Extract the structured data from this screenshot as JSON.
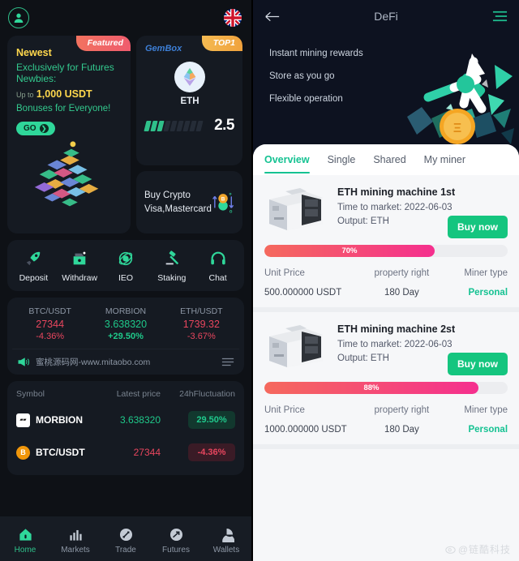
{
  "home": {
    "header": {
      "avatar_name": "user-avatar",
      "language_flag": "uk-flag"
    },
    "promo": {
      "badge": "Featured",
      "title": "Newest",
      "line2": "Exclusively for Futures Newbies:",
      "up_to": "Up to",
      "amount": "1,000 USDT",
      "line4": "Bonuses for Everyone!",
      "cta": "GO"
    },
    "gembox": {
      "label": "GemBox",
      "badge": "TOP1",
      "coin": "ETH",
      "value": "2.5",
      "bars_total": 9,
      "bars_filled": 3
    },
    "buy_crypto": {
      "line1": "Buy Crypto",
      "line2": "Visa,Mastercard"
    },
    "quick_nav": [
      {
        "label": "Deposit",
        "icon": "rocket-icon"
      },
      {
        "label": "Withdraw",
        "icon": "wallet-icon"
      },
      {
        "label": "IEO",
        "icon": "atom-icon"
      },
      {
        "label": "Staking",
        "icon": "gavel-icon"
      },
      {
        "label": "Chat",
        "icon": "headset-icon"
      }
    ],
    "tickers": [
      {
        "symbol": "BTC/USDT",
        "price": "27344",
        "change": "-4.36%",
        "dir": "down"
      },
      {
        "symbol": "MORBION",
        "price": "3.638320",
        "change": "+29.50%",
        "dir": "up"
      },
      {
        "symbol": "ETH/USDT",
        "price": "1739.32",
        "change": "-3.67%",
        "dir": "down"
      }
    ],
    "notice": {
      "text": "蜜桃源码网-www.mitaobo.com"
    },
    "market": {
      "columns": [
        "Symbol",
        "Latest price",
        "24hFluctuation"
      ],
      "rows": [
        {
          "symbol": "MORBION",
          "price": "3.638320",
          "change": "29.50%",
          "dir": "up",
          "icon": "morbion-icon"
        },
        {
          "symbol": "BTC/USDT",
          "price": "27344",
          "change": "-4.36%",
          "dir": "down",
          "icon": "btc-icon"
        }
      ]
    },
    "tabbar": [
      {
        "label": "Home",
        "icon": "home-icon",
        "active": true
      },
      {
        "label": "Markets",
        "icon": "bars-icon",
        "active": false
      },
      {
        "label": "Trade",
        "icon": "trade-icon",
        "active": false
      },
      {
        "label": "Futures",
        "icon": "futures-icon",
        "active": false
      },
      {
        "label": "Wallets",
        "icon": "pie-icon",
        "active": false
      }
    ]
  },
  "defi": {
    "header": {
      "title": "DeFi",
      "back_icon": "back-arrow-icon",
      "menu_icon": "hamburger-icon"
    },
    "hero_lines": [
      "Instant mining rewards",
      "Store as you go",
      "Flexible operation"
    ],
    "tabs": [
      {
        "label": "Overview",
        "active": true
      },
      {
        "label": "Single",
        "active": false
      },
      {
        "label": "Shared",
        "active": false
      },
      {
        "label": "My miner",
        "active": false
      }
    ],
    "spec_columns": [
      "Unit Price",
      "property right",
      "Miner type"
    ],
    "miners": [
      {
        "name": "ETH mining machine 1st",
        "time_label": "Time to market:",
        "time_value": "2022-06-03",
        "output_label": "Output:",
        "output_value": "ETH",
        "buy_label": "Buy now",
        "progress": "70%",
        "progress_pct": 70,
        "unit_price": "500.000000 USDT",
        "property_right": "180 Day",
        "miner_type": "Personal"
      },
      {
        "name": "ETH mining machine 2st",
        "time_label": "Time to market:",
        "time_value": "2022-06-03",
        "output_label": "Output:",
        "output_value": "ETH",
        "buy_label": "Buy now",
        "progress": "88%",
        "progress_pct": 88,
        "unit_price": "1000.000000 USDT",
        "property_right": "180 Day",
        "miner_type": "Personal"
      }
    ],
    "watermark": "@链酷科技"
  },
  "colors": {
    "accent_green": "#2fc08a",
    "defi_green": "#15c292",
    "up_green": "#20c98c",
    "down_red": "#e8465e",
    "gold": "#ffd84d",
    "progress_start": "#f5695d",
    "progress_end": "#f52f8e"
  }
}
